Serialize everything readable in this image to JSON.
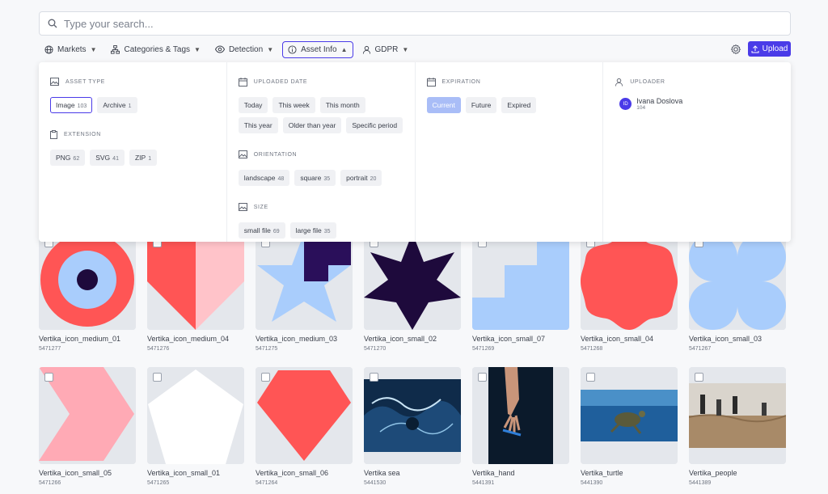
{
  "search": {
    "placeholder": "Type your search..."
  },
  "filters": [
    {
      "label": "Markets",
      "icon": "globe-icon"
    },
    {
      "label": "Categories & Tags",
      "icon": "sitemap-icon"
    },
    {
      "label": "Detection",
      "icon": "eye-icon"
    },
    {
      "label": "Asset Info",
      "icon": "info-icon",
      "active": true
    },
    {
      "label": "GDPR",
      "icon": "user-icon"
    }
  ],
  "upload_label": "Upload",
  "panel": {
    "asset_type": {
      "title": "ASSET TYPE",
      "chips": [
        {
          "label": "Image",
          "count": "103"
        },
        {
          "label": "Archive",
          "count": "1"
        }
      ]
    },
    "extension": {
      "title": "EXTENSION",
      "chips": [
        {
          "label": "PNG",
          "count": "62"
        },
        {
          "label": "SVG",
          "count": "41"
        },
        {
          "label": "ZIP",
          "count": "1"
        }
      ]
    },
    "uploaded_date": {
      "title": "UPLOADED DATE",
      "chips": [
        "Today",
        "This week",
        "This month",
        "This year",
        "Older than year",
        "Specific period"
      ]
    },
    "orientation": {
      "title": "ORIENTATION",
      "chips": [
        {
          "label": "landscape",
          "count": "48"
        },
        {
          "label": "square",
          "count": "35"
        },
        {
          "label": "portrait",
          "count": "20"
        }
      ]
    },
    "size": {
      "title": "SIZE",
      "chips": [
        {
          "label": "small file",
          "count": "69"
        },
        {
          "label": "large file",
          "count": "35"
        }
      ]
    },
    "expiration": {
      "title": "EXPIRATION",
      "chips": [
        "Current",
        "Future",
        "Expired"
      ]
    },
    "uploader": {
      "title": "UPLOADER",
      "initials": "ID",
      "name": "Ivana Doslova",
      "count": "104"
    }
  },
  "assets": [
    {
      "name": "Vertika_icon_medium_01",
      "id": "5471277"
    },
    {
      "name": "Vertika_icon_medium_04",
      "id": "5471276"
    },
    {
      "name": "Vertika_icon_medium_03",
      "id": "5471275"
    },
    {
      "name": "Vertika_icon_small_02",
      "id": "5471270"
    },
    {
      "name": "Vertika_icon_small_07",
      "id": "5471269"
    },
    {
      "name": "Vertika_icon_small_04",
      "id": "5471268"
    },
    {
      "name": "Vertika_icon_small_03",
      "id": "5471267"
    },
    {
      "name": "Vertika_icon_small_05",
      "id": "5471266"
    },
    {
      "name": "Vertika_icon_small_01",
      "id": "5471265"
    },
    {
      "name": "Vertika_icon_small_06",
      "id": "5471264"
    },
    {
      "name": "Vertika sea",
      "id": "5441530"
    },
    {
      "name": "Vertika_hand",
      "id": "5441391"
    },
    {
      "name": "Vertika_turtle",
      "id": "5441390"
    },
    {
      "name": "Vertika_people",
      "id": "5441389"
    }
  ],
  "colors": {
    "accent": "#4a3be8",
    "red": "#ff5555",
    "blue": "#a9cdfc",
    "navy": "#1e0a3c",
    "pink": "#ffaab5"
  }
}
